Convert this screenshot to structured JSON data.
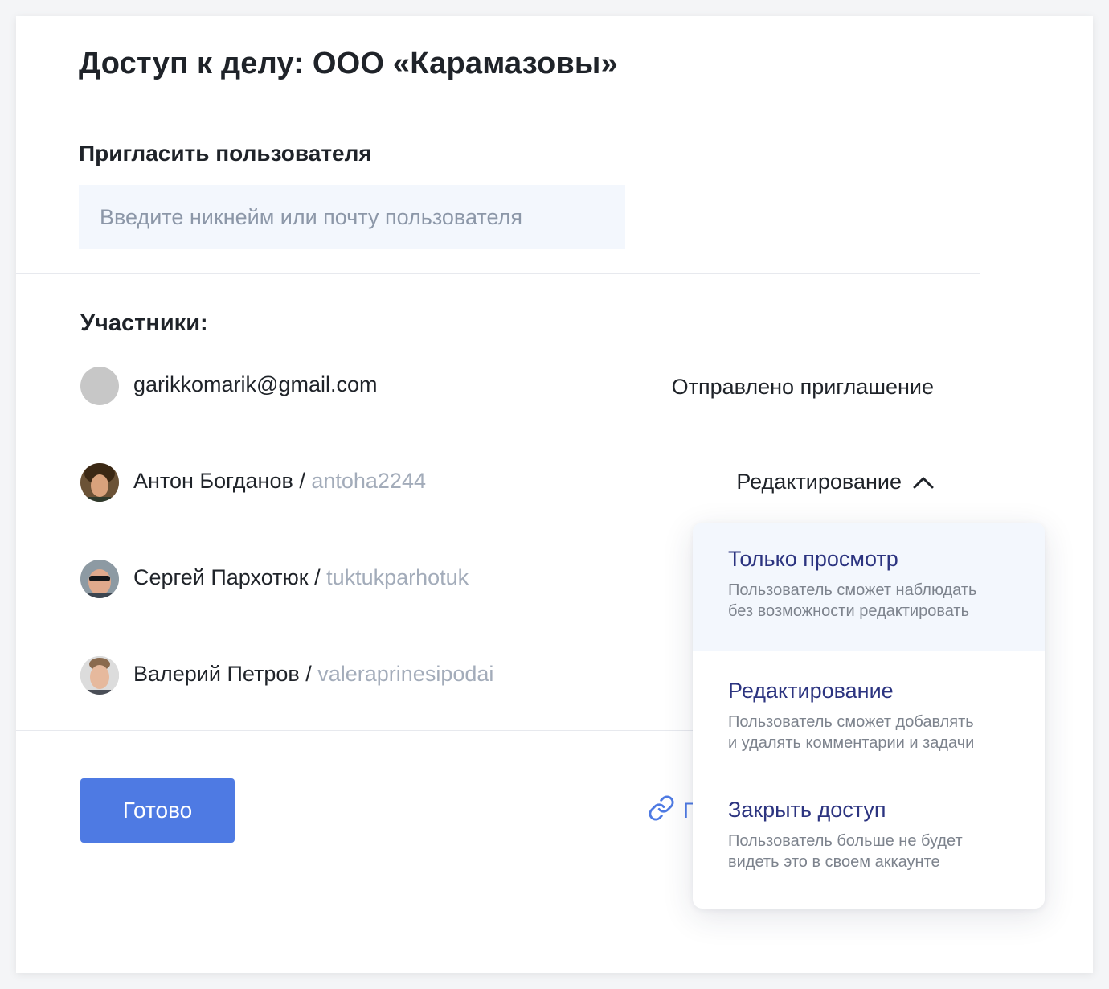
{
  "modal": {
    "title": "Доступ к делу: ООО «Карамазовы»"
  },
  "invite": {
    "label": "Пригласить пользователя",
    "placeholder": "Введите никнейм или почту пользователя",
    "value": ""
  },
  "members": {
    "label": "Участники:",
    "list": [
      {
        "name": "garikkomarik@gmail.com",
        "nickname": "",
        "status": "Отправлено приглашение",
        "avatar": "placeholder-avatar"
      },
      {
        "name": "Антон Богданов / ",
        "nickname": "antoha2244",
        "role": "Редактирование",
        "role_open": true,
        "avatar": "photo-avatar"
      },
      {
        "name": "Сергей Пархотюк / ",
        "nickname": "tuktukparhotuk",
        "avatar": "photo-avatar"
      },
      {
        "name": "Валерий Петров / ",
        "nickname": "valeraprinesipodai",
        "avatar": "photo-avatar"
      }
    ]
  },
  "footer": {
    "done_label": "Готово",
    "link_label": "Г",
    "link_icon": "link-icon"
  },
  "dropdown": {
    "options": [
      {
        "title": "Только просмотр",
        "description": "Пользователь сможет наблюдать\nбез возможности редактировать",
        "highlighted": true
      },
      {
        "title": "Редактирование",
        "description": "Пользователь сможет добавлять\nи удалять комментарии и задачи",
        "highlighted": false
      },
      {
        "title": "Закрыть доступ",
        "description": "Пользователь больше не будет\nвидеть это в своем аккаунте",
        "highlighted": false
      }
    ]
  },
  "colors": {
    "accent": "#4e7ae3",
    "option_title": "#2c3480",
    "muted": "#a3acba",
    "input_bg": "#f3f7fd"
  }
}
